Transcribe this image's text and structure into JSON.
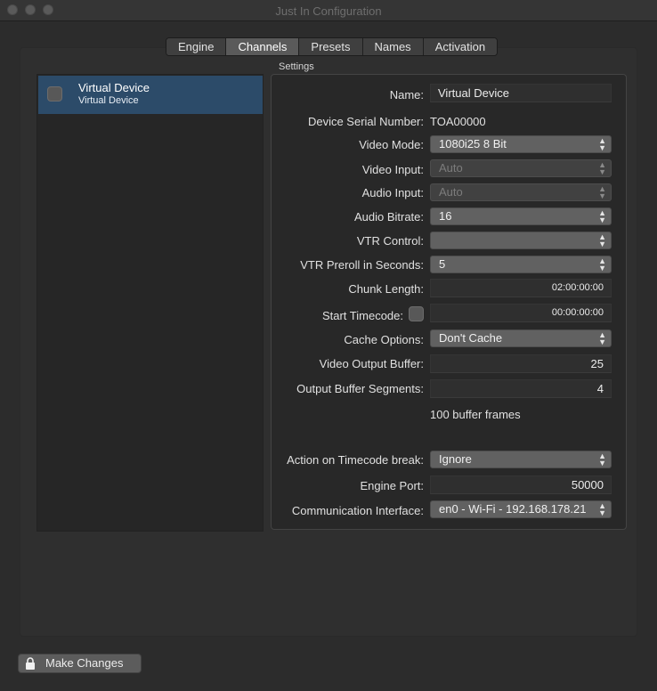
{
  "window": {
    "title": "Just In Configuration"
  },
  "tabs": [
    {
      "label": "Engine",
      "active": false
    },
    {
      "label": "Channels",
      "active": true
    },
    {
      "label": "Presets",
      "active": false
    },
    {
      "label": "Names",
      "active": false
    },
    {
      "label": "Activation",
      "active": false
    }
  ],
  "devices": [
    {
      "name": "Virtual Device",
      "subtitle": "Virtual Device",
      "checked": false
    }
  ],
  "settings": {
    "group_label": "Settings",
    "name": {
      "label": "Name:",
      "value": "Virtual Device"
    },
    "serial": {
      "label": "Device Serial Number:",
      "value": "TOA00000"
    },
    "video_mode": {
      "label": "Video Mode:",
      "value": "1080i25 8 Bit"
    },
    "video_input": {
      "label": "Video Input:",
      "value": "Auto"
    },
    "audio_input": {
      "label": "Audio Input:",
      "value": "Auto"
    },
    "audio_bitrate": {
      "label": "Audio Bitrate:",
      "value": "16"
    },
    "vtr_control": {
      "label": "VTR Control:",
      "value": ""
    },
    "vtr_preroll": {
      "label": "VTR Preroll in Seconds:",
      "value": "5"
    },
    "chunk_length": {
      "label": "Chunk Length:",
      "value": "02:00:00:00"
    },
    "start_timecode": {
      "label": "Start Timecode:",
      "value": "00:00:00:00",
      "checked": false
    },
    "cache_options": {
      "label": "Cache Options:",
      "value": "Don't Cache"
    },
    "video_output_buffer": {
      "label": "Video Output Buffer:",
      "value": "25"
    },
    "output_buffer_segments": {
      "label": "Output Buffer Segments:",
      "value": "4"
    },
    "buffer_info": "100 buffer frames",
    "timecode_break": {
      "label": "Action on Timecode break:",
      "value": "Ignore"
    },
    "engine_port": {
      "label": "Engine Port:",
      "value": "50000"
    },
    "comm_interface": {
      "label": "Communication Interface:",
      "value": "en0 - Wi-Fi - 192.168.178.21"
    }
  },
  "footer": {
    "make_changes_label": "Make Changes"
  },
  "icons": {
    "lock": "lock-icon",
    "popup_arrows": "updown-arrows-icon"
  },
  "colors": {
    "selection": "#2c4b69",
    "background": "#2c2c2c",
    "control": "#616161"
  }
}
